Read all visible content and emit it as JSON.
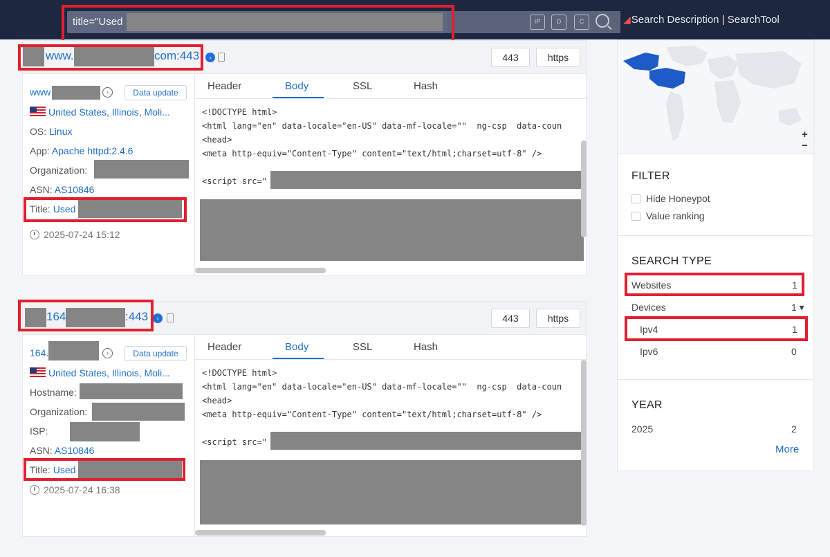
{
  "search": {
    "query": "title=\"Used",
    "tool_icons": [
      "ip-search-icon",
      "image-search-icon",
      "scan-icon",
      "search-icon"
    ],
    "tool_labels": [
      "IP",
      "D",
      "C"
    ],
    "description_link": "Search Description | SearchTool"
  },
  "results": [
    {
      "host_prefix": "www.",
      "host_suffix": "com:443",
      "port": "443",
      "protocol": "https",
      "subhost": "www",
      "update_label": "Data update",
      "location": "United States, Illinois, Moli...",
      "fields": [
        {
          "label": "OS: ",
          "value": "Linux"
        },
        {
          "label": "App: ",
          "value": "Apache httpd:2.4.6"
        },
        {
          "label": "Organization: ",
          "value": ""
        },
        {
          "label": "ASN: ",
          "value": "AS10846"
        },
        {
          "label": "Title: ",
          "value": "Used"
        }
      ],
      "timestamp": "2025-07-24 15:12"
    },
    {
      "host_prefix": "164",
      "host_suffix": ":443",
      "port": "443",
      "protocol": "https",
      "subhost": "164.",
      "update_label": "Data update",
      "location": "United States, Illinois, Moli...",
      "fields": [
        {
          "label": "Hostname:",
          "value": ""
        },
        {
          "label": "Organization:",
          "value": ""
        },
        {
          "label": "ISP: ",
          "value": ""
        },
        {
          "label": "ASN: ",
          "value": "AS10846"
        },
        {
          "label": "Title: ",
          "value": "Used"
        }
      ],
      "timestamp": "2025-07-24 16:38"
    }
  ],
  "tabs": [
    "Header",
    "Body",
    "SSL",
    "Hash"
  ],
  "code_lines": [
    "<!DOCTYPE html>",
    "<html lang=\"en\" data-locale=\"en-US\" data-mf-locale=\"\"  ng-csp  data-coun",
    "<head>",
    "<meta http-equiv=\"Content-Type\" content=\"text/html;charset=utf-8\" />",
    "",
    "<script src=\""
  ],
  "sidebar": {
    "zoom_in": "+",
    "zoom_out": "−",
    "filter_title": "FILTER",
    "filters": [
      "Hide Honeypot",
      "Value ranking"
    ],
    "search_type_title": "SEARCH TYPE",
    "types": [
      {
        "label": "Websites",
        "count": "1"
      },
      {
        "label": "Devices",
        "count": "1 ▾"
      },
      {
        "label": "Ipv4",
        "count": "1"
      },
      {
        "label": "Ipv6",
        "count": "0"
      }
    ],
    "year_title": "YEAR",
    "years": [
      {
        "label": "2025",
        "count": "2"
      }
    ],
    "more": "More"
  },
  "colors": {
    "accent": "#1d6fc9",
    "highlight": "#e02030",
    "topbar": "#1d2740"
  }
}
